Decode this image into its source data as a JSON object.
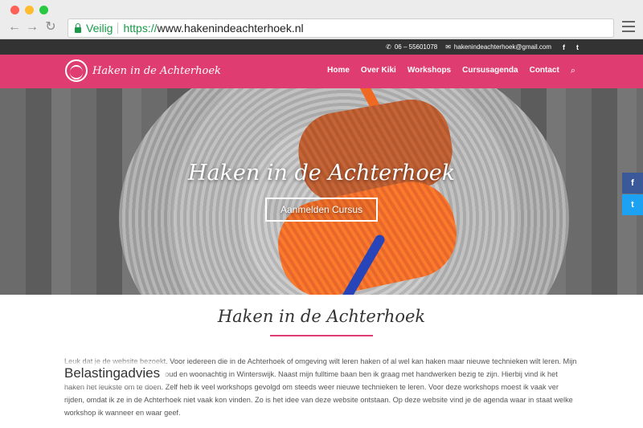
{
  "browser": {
    "secure_label": "Veilig",
    "url_protocol": "https://",
    "url_host": "www.hakenindeachterhoek.nl"
  },
  "topbar": {
    "phone": "06 – 55601078",
    "email": "hakenindeachterhoek@gmail.com",
    "social": [
      "f",
      "t"
    ]
  },
  "nav": {
    "logo_text": "Haken in de Achterhoek",
    "links": [
      "Home",
      "Over Kiki",
      "Workshops",
      "Cursusagenda",
      "Contact"
    ],
    "search_icon": "⌕"
  },
  "hero": {
    "title": "Haken in de Achterhoek",
    "button_label": "Aanmelden Cursus"
  },
  "share": {
    "facebook": "f",
    "twitter": "t"
  },
  "content": {
    "title": "Haken in de Achterhoek",
    "paragraph": "Leuk dat je de website bezoekt. Voor iedereen die in de Achterhoek of omgeving wilt leren haken of al wel kan haken maar nieuwe technieken wilt leren. Mijn naam is Kiki Damdam, 28 jaar oud en woonachtig in Winterswijk. Naast mijn fulltime baan ben ik graag met handwerken bezig te zijn. Hierbij vind ik het haken het leukste om te doen. Zelf heb ik veel workshops gevolgd om steeds weer nieuwe technieken te leren. Voor deze workshops moest ik vaak ver rijden, omdat ik ze in de Achterhoek niet vaak kon vinden. Zo is het idee van deze website ontstaan. Op deze website vind je de agenda waar in staat welke workshop ik wanneer en waar geef.",
    "overlay_label": "Belastingadvies"
  },
  "colors": {
    "brand_pink": "#df3d72",
    "topbar": "#333333",
    "secure_green": "#1a9a48"
  }
}
